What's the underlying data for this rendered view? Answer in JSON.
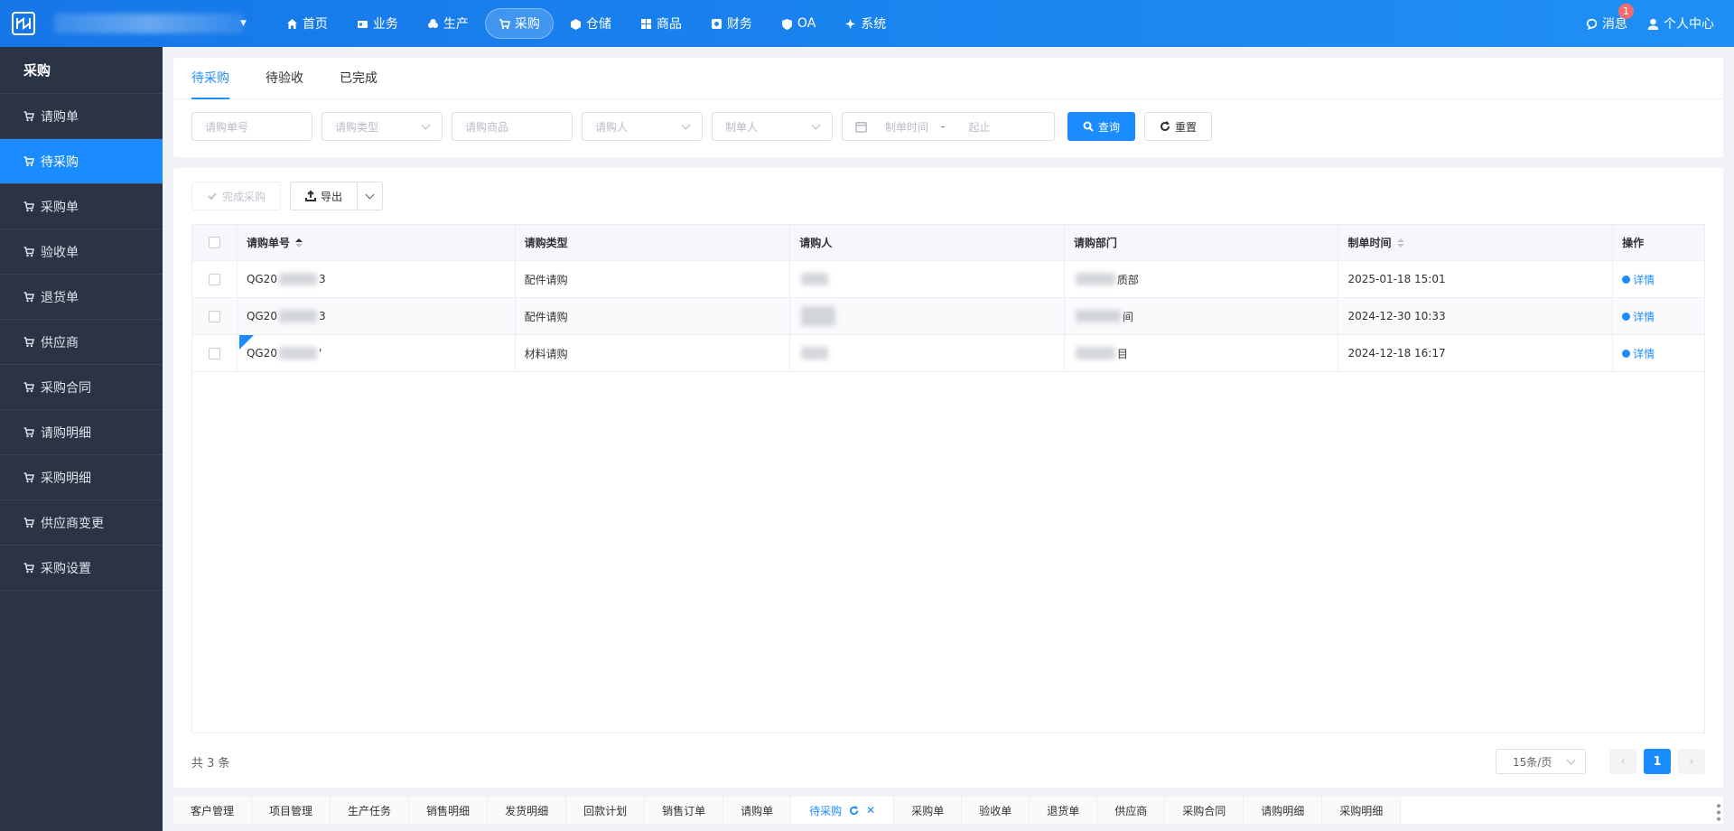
{
  "header": {
    "nav": [
      {
        "label": "首页",
        "icon": "home-icon",
        "active": false
      },
      {
        "label": "业务",
        "icon": "business-icon",
        "active": false
      },
      {
        "label": "生产",
        "icon": "production-icon",
        "active": false
      },
      {
        "label": "采购",
        "icon": "cart-icon",
        "active": true
      },
      {
        "label": "仓储",
        "icon": "warehouse-icon",
        "active": false
      },
      {
        "label": "商品",
        "icon": "goods-icon",
        "active": false
      },
      {
        "label": "财务",
        "icon": "finance-icon",
        "active": false
      },
      {
        "label": "OA",
        "icon": "shield-icon",
        "active": false
      },
      {
        "label": "系统",
        "icon": "system-icon",
        "active": false
      }
    ],
    "messages_label": "消息",
    "messages_count": "1",
    "profile_label": "个人中心"
  },
  "sidebar": {
    "title": "采购",
    "items": [
      {
        "label": "请购单",
        "active": false
      },
      {
        "label": "待采购",
        "active": true
      },
      {
        "label": "采购单",
        "active": false
      },
      {
        "label": "验收单",
        "active": false
      },
      {
        "label": "退货单",
        "active": false
      },
      {
        "label": "供应商",
        "active": false
      },
      {
        "label": "采购合同",
        "active": false
      },
      {
        "label": "请购明细",
        "active": false
      },
      {
        "label": "采购明细",
        "active": false
      },
      {
        "label": "供应商变更",
        "active": false
      },
      {
        "label": "采购设置",
        "active": false
      }
    ]
  },
  "tabs": [
    {
      "label": "待采购",
      "active": true
    },
    {
      "label": "待验收",
      "active": false
    },
    {
      "label": "已完成",
      "active": false
    }
  ],
  "filters": {
    "order_no_placeholder": "请购单号",
    "type_placeholder": "请购类型",
    "goods_placeholder": "请购商品",
    "requester_placeholder": "请购人",
    "creator_placeholder": "制单人",
    "date_start_placeholder": "制单时间",
    "date_separator": "-",
    "date_end_placeholder": "起止",
    "search_label": "查询",
    "reset_label": "重置"
  },
  "toolbar": {
    "complete_label": "完成采购",
    "export_label": "导出"
  },
  "table": {
    "columns": [
      "请购单号",
      "请购类型",
      "请购人",
      "请购部门",
      "制单时间",
      "操作"
    ],
    "rows": [
      {
        "order_no_prefix": "QG20",
        "order_no_suffix": "3",
        "type": "配件请购",
        "requester_suffix": "",
        "dept_suffix": "质部",
        "time": "2025-01-18 15:01",
        "action": "详情"
      },
      {
        "order_no_prefix": "QG20",
        "order_no_suffix": "3",
        "type": "配件请购",
        "requester_suffix": "",
        "dept_suffix": "间",
        "time": "2024-12-30 10:33",
        "action": "详情"
      },
      {
        "order_no_prefix": "QG20",
        "order_no_suffix": "'",
        "type": "材料请购",
        "requester_suffix": "",
        "dept_suffix": "目",
        "time": "2024-12-18 16:17",
        "action": "详情"
      }
    ]
  },
  "pagination": {
    "total_label": "共 3 条",
    "page_size": "15条/页",
    "current_page": "1"
  },
  "bottom_tabs": [
    {
      "label": "客户管理",
      "active": false
    },
    {
      "label": "项目管理",
      "active": false
    },
    {
      "label": "生产任务",
      "active": false
    },
    {
      "label": "销售明细",
      "active": false
    },
    {
      "label": "发货明细",
      "active": false
    },
    {
      "label": "回款计划",
      "active": false
    },
    {
      "label": "销售订单",
      "active": false
    },
    {
      "label": "请购单",
      "active": false
    },
    {
      "label": "待采购",
      "active": true
    },
    {
      "label": "采购单",
      "active": false
    },
    {
      "label": "验收单",
      "active": false
    },
    {
      "label": "退货单",
      "active": false
    },
    {
      "label": "供应商",
      "active": false
    },
    {
      "label": "采购合同",
      "active": false
    },
    {
      "label": "请购明细",
      "active": false
    },
    {
      "label": "采购明细",
      "active": false
    }
  ],
  "colors": {
    "primary": "#1a8cff",
    "sidebar_bg": "#2b3445",
    "header_bg": "#1677e8",
    "badge": "#f56c6c"
  }
}
